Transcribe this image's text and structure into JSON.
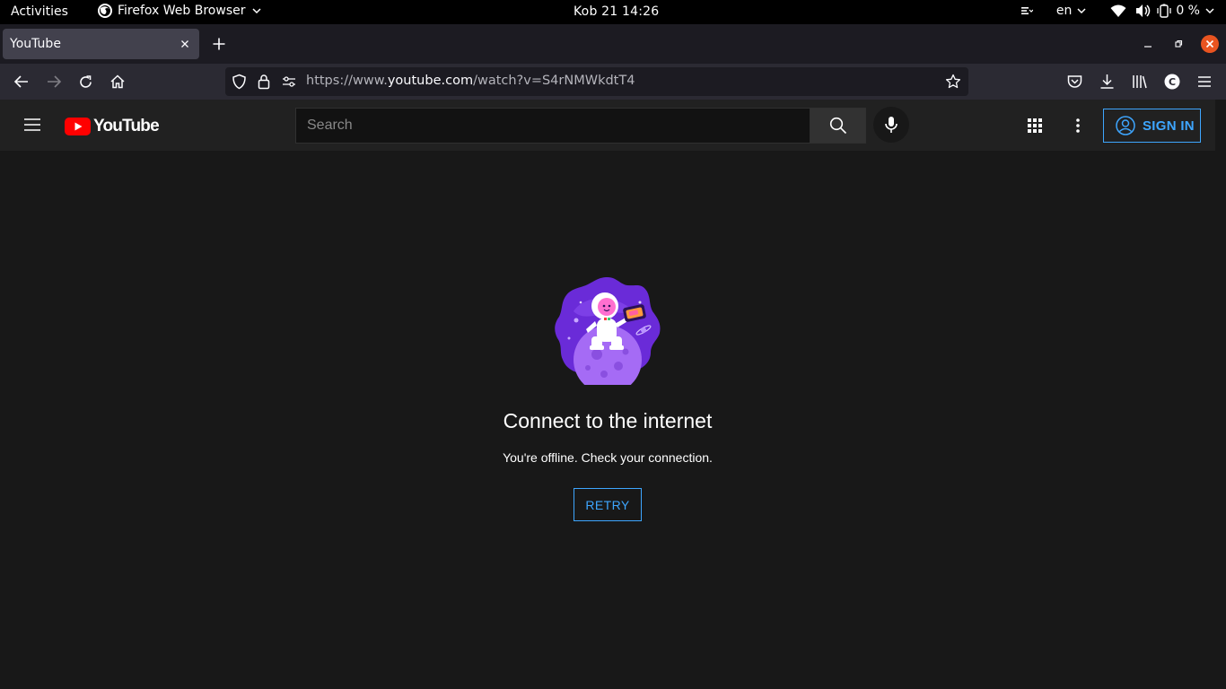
{
  "system": {
    "activities": "Activities",
    "app_name": "Firefox Web Browser",
    "clock": "Kob 21  14:26",
    "language": "en",
    "battery": "0 %"
  },
  "browser": {
    "tab_title": "YouTube",
    "url_prefix": "https://www.",
    "url_domain": "youtube.com",
    "url_path": "/watch?v=S4rNMWkdtT4",
    "profile_initial": "C"
  },
  "youtube": {
    "logo_text": "YouTube",
    "search_placeholder": "Search",
    "sign_in": "SIGN IN",
    "offline_title": "Connect to the internet",
    "offline_message": "You're offline. Check your connection.",
    "retry_label": "RETRY"
  },
  "colors": {
    "yt_red": "#ff0000",
    "link_blue": "#3ea6ff",
    "page_bg": "#181818",
    "masthead_bg": "#212121"
  }
}
